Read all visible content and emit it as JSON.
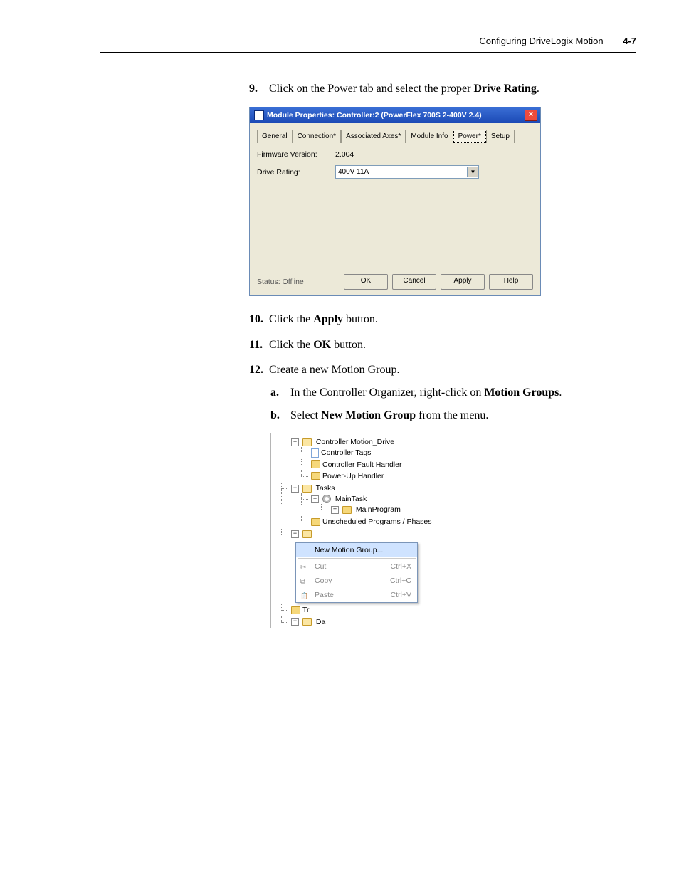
{
  "header": {
    "title": "Configuring DriveLogix Motion",
    "page": "4-7"
  },
  "steps": {
    "s9": {
      "num": "9.",
      "pre": "Click on the Power tab and select the proper ",
      "bold": "Drive Rating",
      "post": "."
    },
    "s10": {
      "num": "10.",
      "pre": "Click the ",
      "bold": "Apply",
      "post": " button."
    },
    "s11": {
      "num": "11.",
      "pre": "Click the ",
      "bold": "OK",
      "post": " button."
    },
    "s12": {
      "num": "12.",
      "text": "Create a new Motion Group."
    },
    "s12a": {
      "letter": "a.",
      "pre": "In the Controller Organizer, right-click on ",
      "bold": "Motion Groups",
      "post": "."
    },
    "s12b": {
      "letter": "b.",
      "pre": "Select ",
      "bold": "New Motion Group",
      "post": " from the menu."
    }
  },
  "dialog": {
    "title": "Module Properties: Controller:2 (PowerFlex 700S 2-400V 2.4)",
    "tabs": {
      "t0": "General",
      "t1": "Connection*",
      "t2": "Associated Axes*",
      "t3": "Module Info",
      "t4": "Power*",
      "t5": "Setup"
    },
    "firmware_label": "Firmware Version:",
    "firmware_value": "2.004",
    "rating_label": "Drive Rating:",
    "rating_value": "400V 11A",
    "status_label": "Status:",
    "status_value": "Offline",
    "btn_ok": "OK",
    "btn_cancel": "Cancel",
    "btn_apply": "Apply",
    "btn_help": "Help"
  },
  "tree": {
    "root": "Controller Motion_Drive",
    "ctrl_tags": "Controller Tags",
    "fault_handler": "Controller Fault Handler",
    "powerup": "Power-Up Handler",
    "tasks": "Tasks",
    "maintask": "MainTask",
    "mainprog": "MainProgram",
    "unsched": "Unscheduled Programs / Phases",
    "trends_prefix": "Tr",
    "data_prefix": "Da"
  },
  "context_menu": {
    "new_group": "New Motion Group...",
    "cut": "Cut",
    "cut_sc": "Ctrl+X",
    "copy": "Copy",
    "copy_sc": "Ctrl+C",
    "paste": "Paste",
    "paste_sc": "Ctrl+V"
  }
}
